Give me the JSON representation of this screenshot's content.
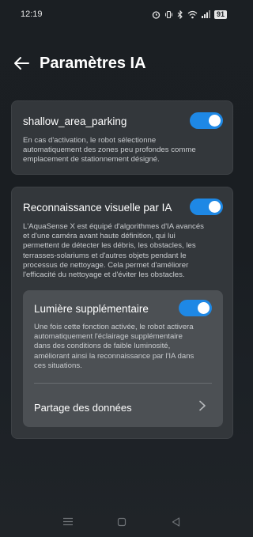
{
  "status": {
    "time": "12:19",
    "battery": "91"
  },
  "header": {
    "title": "Paramètres IA"
  },
  "settings": {
    "shallow": {
      "title": "shallow_area_parking",
      "description_lines": [
        "En cas d'activation, le robot sélectionne",
        "automatiquement des zones peu profondes comme",
        "emplacement de stationnement désigné."
      ],
      "enabled": true
    },
    "visual": {
      "title": "Reconnaissance visuelle par IA",
      "description_lines": [
        "L'AquaSense X est équipé d'algorithmes d'IA avancés",
        "et d'une caméra avant haute définition, qui lui",
        "permettent de détecter les débris, les obstacles, les",
        "terrasses-solariums et d'autres objets pendant le",
        "processus de nettoyage. Cela permet d'améliorer",
        "l'efficacité du nettoyage et d'éviter les obstacles."
      ],
      "enabled": true
    },
    "light": {
      "title": "Lumière supplémentaire",
      "description_lines": [
        "Une fois cette fonction activée, le robot activera",
        "automatiquement l'éclairage supplémentaire",
        "dans des conditions de faible luminosité,",
        "améliorant ainsi la reconnaissance par l'IA dans",
        "ces situations."
      ],
      "enabled": true
    },
    "data_sharing": {
      "label": "Partage des données"
    }
  },
  "colors": {
    "accent": "#1e88e5",
    "card": "#33373b",
    "subcard": "#4c5054"
  }
}
